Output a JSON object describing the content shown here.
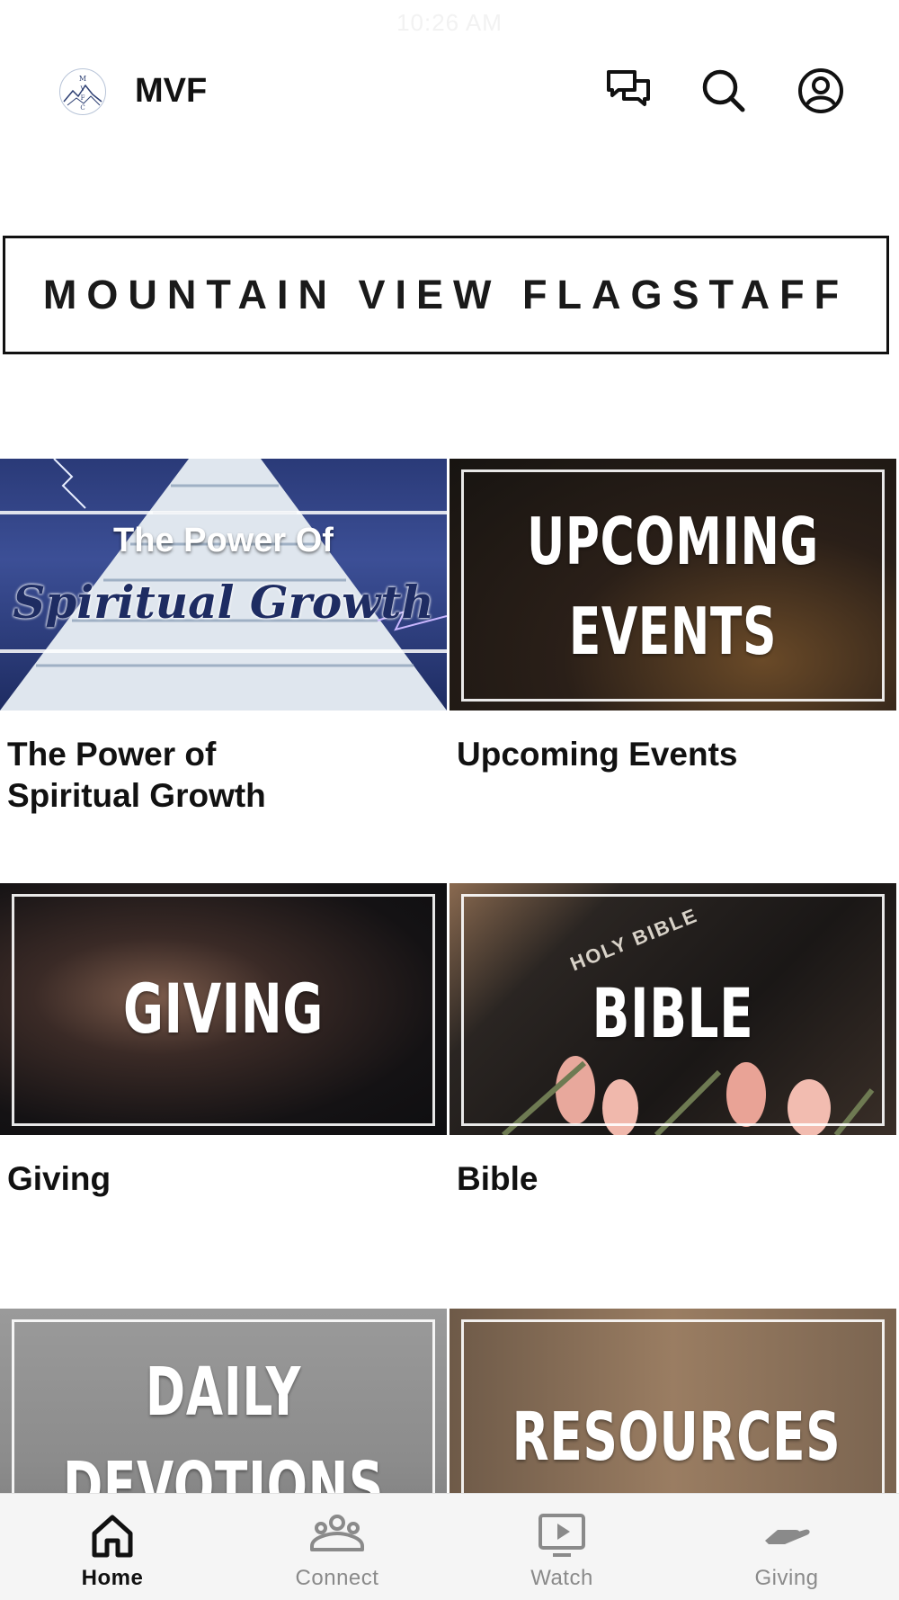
{
  "status": {
    "time": "10:26 AM"
  },
  "header": {
    "logo_letters": "MVFC",
    "title": "MVF",
    "icons": [
      "chat-icon",
      "search-icon",
      "profile-icon"
    ]
  },
  "banner": {
    "text": "MOUNTAIN VIEW FLAGSTAFF"
  },
  "tiles": [
    {
      "overlay_line1": "The Power Of",
      "overlay_line2": "Spiritual Growth",
      "caption_line1": "The Power of",
      "caption_line2": "Spiritual Growth"
    },
    {
      "overlay_line1": "UPCOMING",
      "overlay_line2": "EVENTS",
      "caption_line1": "Upcoming Events"
    },
    {
      "overlay_line1": "GIVING",
      "caption_line1": "Giving"
    },
    {
      "overlay_small": "HOLY BIBLE",
      "overlay_line1": "BIBLE",
      "caption_line1": "Bible"
    },
    {
      "overlay_line1": "DAILY",
      "overlay_line2": "DEVOTIONS"
    },
    {
      "overlay_line1": "RESOURCES"
    }
  ],
  "bottom_nav": {
    "active_color": "#111111",
    "inactive_color": "#8a8a8a",
    "items": [
      {
        "label": "Home",
        "icon": "home-icon",
        "active": true
      },
      {
        "label": "Connect",
        "icon": "group-icon",
        "active": false
      },
      {
        "label": "Watch",
        "icon": "play-screen-icon",
        "active": false
      },
      {
        "label": "Giving",
        "icon": "giving-hand-icon",
        "active": false
      }
    ]
  }
}
